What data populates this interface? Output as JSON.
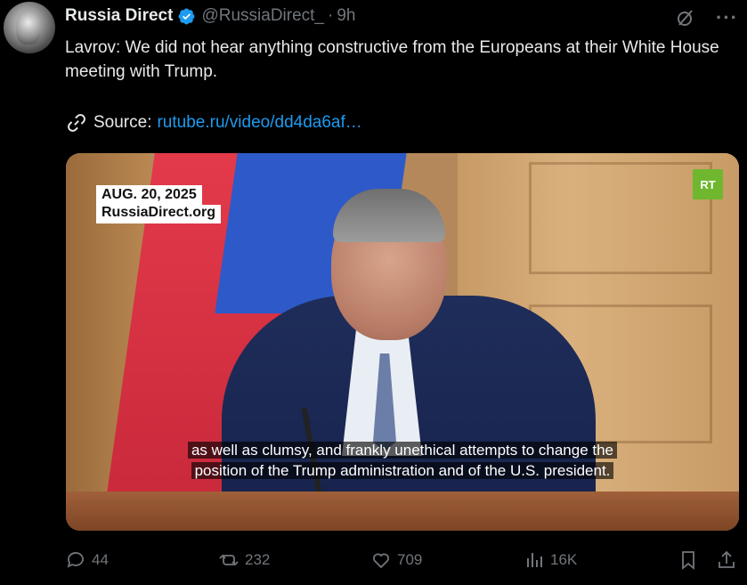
{
  "tweet": {
    "author_name": "Russia Direct",
    "handle": "@RussiaDirect_",
    "separator": "·",
    "time": "9h",
    "text": "Lavrov: We did not hear anything constructive from the Europeans at their White House meeting with Trump.",
    "source_label": "Source:",
    "source_url": "rutube.ru/video/dd4da6af…"
  },
  "media": {
    "date_overlay": "AUG. 20, 2025",
    "site_overlay": "RussiaDirect.org",
    "logo_text": "RT",
    "subtitle_line1": "as well as clumsy, and frankly unethical attempts to change the",
    "subtitle_line2": "position of the Trump administration and of the U.S. president."
  },
  "actions": {
    "replies": "44",
    "reposts": "232",
    "likes": "709",
    "views": "16K"
  },
  "icons": {
    "more": "more-icon",
    "grok": "grok-icon"
  },
  "colors": {
    "background": "#000000",
    "link": "#1d9bf0",
    "muted": "#71767b",
    "verified": "#1d9bf0"
  }
}
